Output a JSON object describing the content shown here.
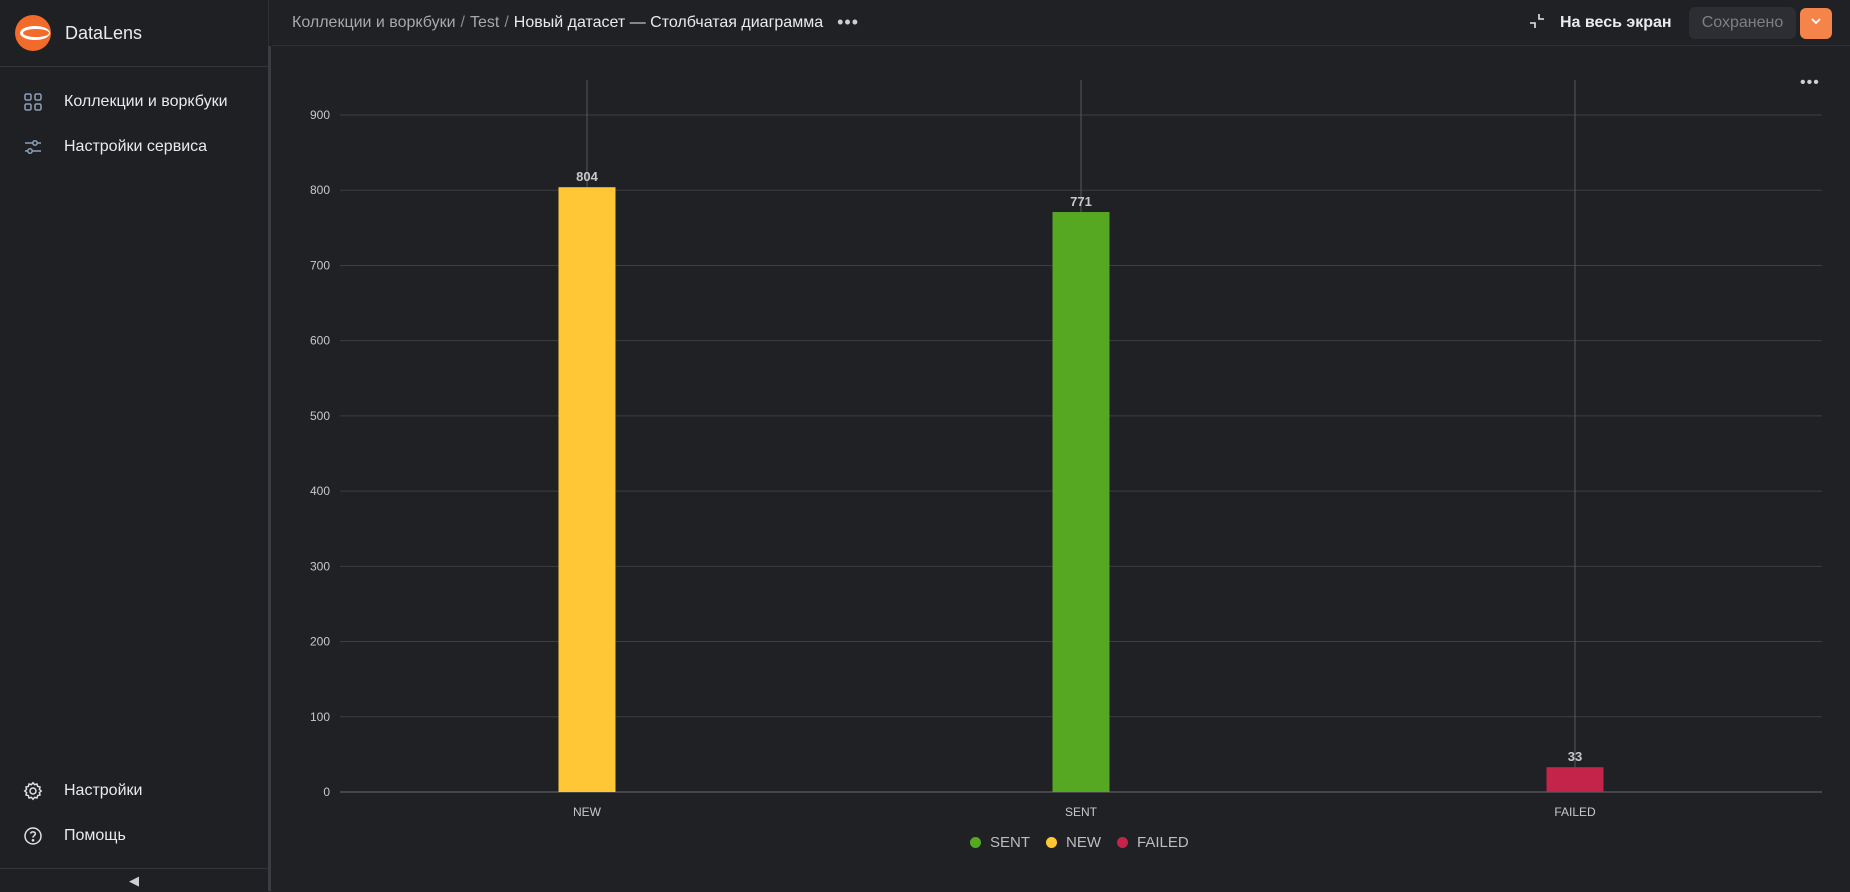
{
  "sidebar": {
    "brand": "DataLens",
    "items": [
      {
        "label": "Коллекции и воркбуки",
        "icon": "grid-icon"
      },
      {
        "label": "Настройки сервиса",
        "icon": "sliders-icon"
      }
    ],
    "bottom_items": [
      {
        "label": "Настройки",
        "icon": "gear-icon"
      },
      {
        "label": "Помощь",
        "icon": "help-icon"
      }
    ],
    "collapse_icon": "◀"
  },
  "header": {
    "breadcrumbs": [
      "Коллекции и воркбуки",
      "Test"
    ],
    "separator": "/",
    "current": "Новый датасет — Столбчатая диаграмма",
    "more": "•••",
    "fullscreen_label": "На весь экран",
    "saved_label": "Сохранено"
  },
  "colors": {
    "accent": "#f5844a",
    "NEW": "#ffc636",
    "SENT": "#56a823",
    "FAILED": "#c4234a"
  },
  "chart_menu": "•••",
  "chart_data": {
    "type": "bar",
    "categories": [
      "NEW",
      "SENT",
      "FAILED"
    ],
    "values": [
      804,
      771,
      33
    ],
    "colors": [
      "#ffc636",
      "#56a823",
      "#c4234a"
    ],
    "ylim": [
      0,
      900
    ],
    "yticks": [
      0,
      100,
      200,
      300,
      400,
      500,
      600,
      700,
      800,
      900
    ],
    "grid": true,
    "data_labels": true,
    "legend": {
      "position": "bottom",
      "entries": [
        {
          "name": "SENT",
          "color": "#56a823"
        },
        {
          "name": "NEW",
          "color": "#ffc636"
        },
        {
          "name": "FAILED",
          "color": "#c4234a"
        }
      ]
    }
  }
}
